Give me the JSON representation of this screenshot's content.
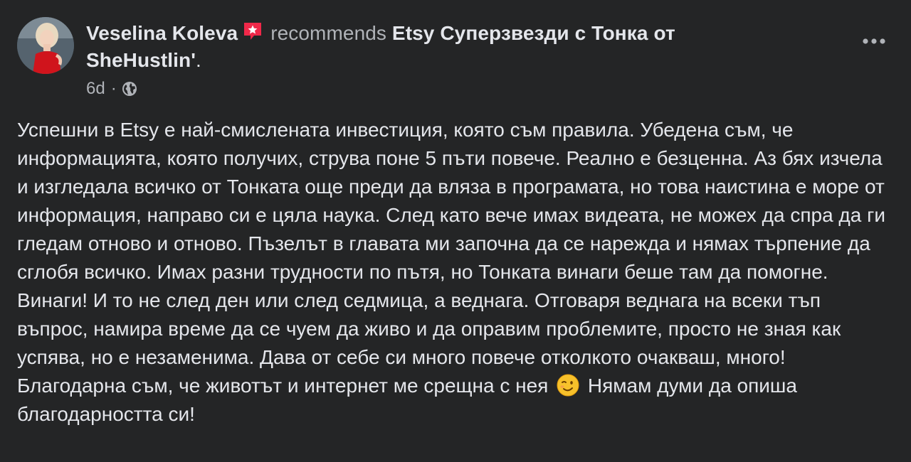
{
  "post": {
    "author": "Veselina Koleva",
    "verb": "recommends",
    "target_line1": "Etsy Суперзвезди с Тонка от",
    "target_line2": "SheHustlin'",
    "trailing": ".",
    "time": "6d",
    "separator": "·",
    "privacy_icon": "globe-icon",
    "author_badge_icon": "recommend-badge-icon",
    "more_icon": "more-horizontal-icon",
    "body_part1": "Успешни в Etsy е най-смислената инвестиция, която съм правила. Убедена съм, че информацията, която получих, струва поне 5 пъти повече. Реално е безценна. Аз бях изчела и изгледала всичко от Тонката още преди да вляза в програмата, но това наистина е море от информация, направо си е цяла наука. След като вече имах видеата, не можех да спра да ги гледам отново и отново. Пъзелът в главата ми започна да се нарежда и нямах търпение да сглобя всичко. Имах разни трудности по пътя, но Тонката винаги беше там да помогне. Винаги! И то не след ден или след седмица, а веднага. Отговаря веднага на всеки тъп въпрос, намира време да се чуем да живо и да оправим проблемите, просто не зная как успява, но е незаменима. Дава от себе си много повече отколкото очакваш, много! Благодарна съм, че животът и интернет ме срещна с нея",
    "body_emoji": "winking-face-emoji",
    "body_part2": "Нямам думи да опиша благодарността си!"
  },
  "colors": {
    "background": "#242526",
    "primary_text": "#e4e6eb",
    "secondary_text": "#b0b3b8",
    "badge": "#f02849"
  }
}
